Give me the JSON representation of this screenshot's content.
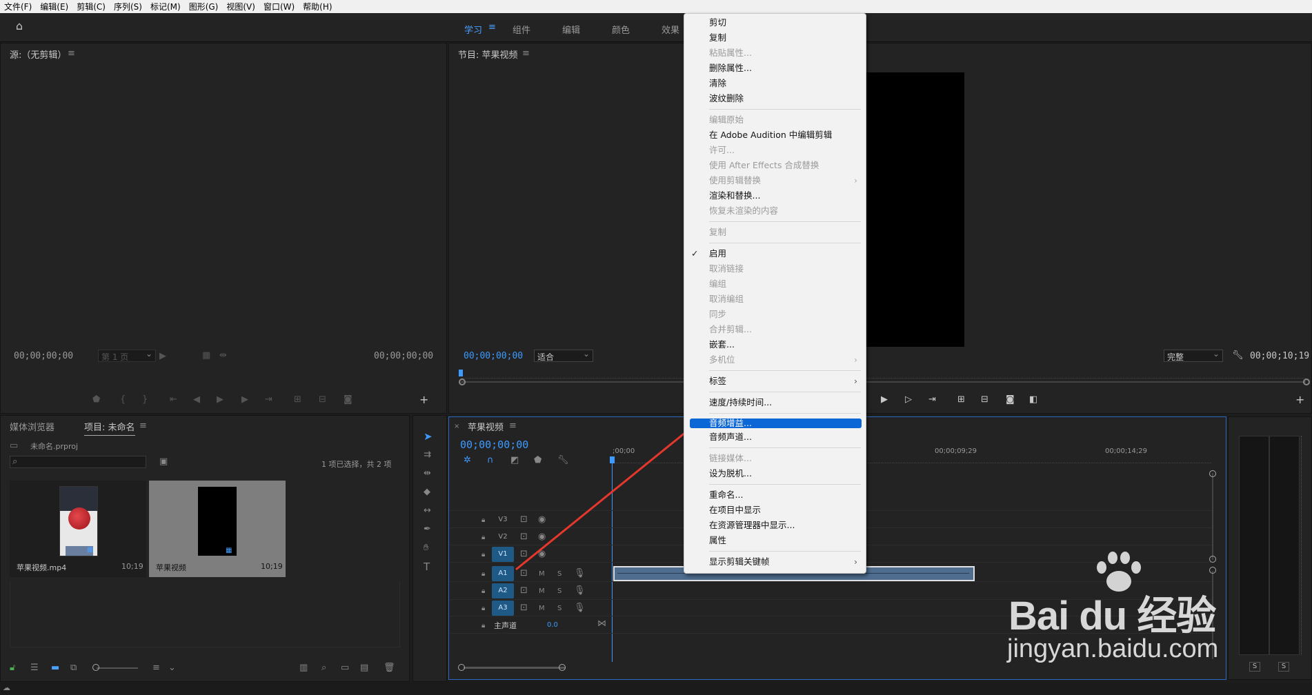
{
  "menubar": [
    "文件(F)",
    "编辑(E)",
    "剪辑(C)",
    "序列(S)",
    "标记(M)",
    "图形(G)",
    "视图(V)",
    "窗口(W)",
    "帮助(H)"
  ],
  "workspaces": {
    "learn": "学习",
    "assemble": "组件",
    "edit": "编辑",
    "color": "颜色",
    "effects": "效果"
  },
  "source": {
    "title": "源:（无剪辑）",
    "tc_left": "00;00;00;00",
    "page": "第 1 页",
    "tc_right": "00;00;00;00"
  },
  "program": {
    "title": "节目: 苹果视频",
    "tc_left": "00;00;00;00",
    "fit": "适合",
    "quality": "完整",
    "tc_right": "00;00;10;19"
  },
  "project": {
    "tab_media": "媒体浏览器",
    "tab_project": "项目: 未命名",
    "file": "未命名.prproj",
    "search_placeholder": "",
    "count": "1 项已选择，共 2 项",
    "items": [
      {
        "name": "苹果视频.mp4",
        "duration": "10;19"
      },
      {
        "name": "苹果视频",
        "duration": "10;19"
      }
    ]
  },
  "timeline": {
    "title": "苹果视频",
    "timecode": "00;00;00;00",
    "ruler": [
      ";00;00",
      "00;00;09;29",
      "00;00;14;29"
    ],
    "tracks": {
      "v3": "V3",
      "v2": "V2",
      "v1": "V1",
      "a1": "A1",
      "a2": "A2",
      "a3": "A3",
      "m": "M",
      "s": "S",
      "master": "主声道",
      "master_val": "0.0"
    }
  },
  "meter": {
    "s1": "S",
    "s2": "S"
  },
  "context_menu": {
    "cut": "剪切",
    "copy": "复制",
    "paste_attr": "粘贴属性...",
    "remove_attr": "删除属性...",
    "clear": "清除",
    "ripple_delete": "波纹删除",
    "edit_original": "编辑原始",
    "edit_audition": "在 Adobe Audition 中编辑剪辑",
    "license": "许可...",
    "ae_replace": "使用 After Effects 合成替换",
    "replace_with_clip": "使用剪辑替换",
    "render_replace": "渲染和替换...",
    "restore_unrendered": "恢复未渲染的内容",
    "duplicate": "复制",
    "enable": "启用",
    "unlink": "取消链接",
    "group": "编组",
    "ungroup": "取消编组",
    "synchronize": "同步",
    "merge_clips": "合并剪辑...",
    "nest": "嵌套...",
    "multicam": "多机位",
    "label": "标签",
    "speed_duration": "速度/持续时间...",
    "audio_gain": "音频增益...",
    "audio_channels": "音频声道...",
    "link_media": "链接媒体...",
    "make_offline": "设为脱机...",
    "rename": "重命名...",
    "reveal_project": "在项目中显示",
    "reveal_explorer": "在资源管理器中显示...",
    "properties": "属性",
    "show_keyframes": "显示剪辑关键帧"
  },
  "watermark": {
    "brand": "Bai du 经验",
    "url": "jingyan.baidu.com"
  }
}
